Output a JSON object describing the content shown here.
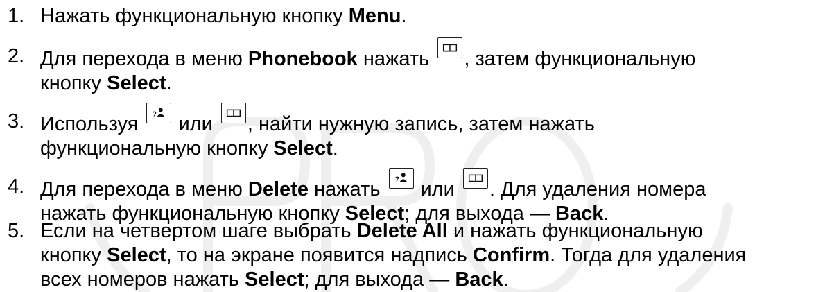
{
  "icons": {
    "phonebook_key": "book-icon",
    "contact_key": "contact-query-icon"
  },
  "watermark": {
    "text": "PRO"
  },
  "steps": [
    {
      "number": "1.",
      "t1": "Нажать функциональную кнопку ",
      "b1": "Menu",
      "t2": "."
    },
    {
      "number": "2.",
      "t1": "Для перехода в меню ",
      "b1": "Phonebook",
      "t2": " нажать ",
      "t3": ", затем функциональную",
      "t4": "кнопку ",
      "b2": "Select",
      "t5": "."
    },
    {
      "number": "3.",
      "t1": "Используя ",
      "t2": " или ",
      "t3": ", найти нужную запись, затем нажать",
      "t4": "функциональную кнопку ",
      "b1": "Select",
      "t5": "."
    },
    {
      "number": "4.",
      "t1": "Для перехода в меню ",
      "b1": "Delete",
      "t2": " нажать ",
      "t3": " или ",
      "t4": ". Для удаления номера",
      "t5": "нажать функциональную кнопку ",
      "b2": "Select",
      "t6": "; для выхода — ",
      "b3": "Back",
      "t7": "."
    },
    {
      "number": "5.",
      "t1": "Если на четвертом шаге выбрать ",
      "b1": "Delete All",
      "t2": " и нажать функциональную",
      "t3": "кнопку ",
      "b2": "Select",
      "t4": ", то на экране появится надпись ",
      "b3": "Confirm",
      "t5": ". Тогда для удаления",
      "t6": "всех номеров нажать ",
      "b4": "Select",
      "t7": "; для выхода — ",
      "b5": "Back",
      "t8": "."
    }
  ]
}
